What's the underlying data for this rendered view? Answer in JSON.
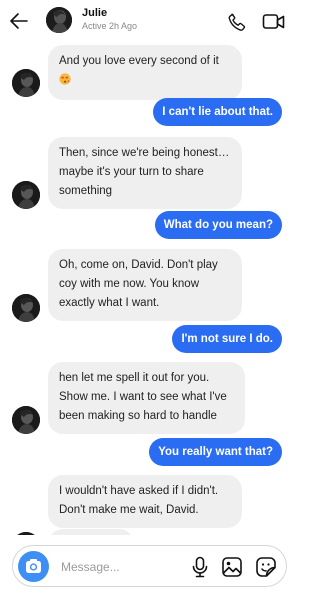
{
  "header": {
    "name": "Julie",
    "status": "Active 2h Ago",
    "icons": [
      "back-arrow-icon",
      "avatar",
      "phone-icon",
      "video-camera-icon"
    ]
  },
  "messages": [
    {
      "from": "them",
      "text": "And you love every second of it",
      "emoji": "heart-eyes-kiss-emoji"
    },
    {
      "from": "me",
      "text": "I can't lie about that."
    },
    {
      "from": "them",
      "text": "Then, since we're being honest… maybe it's your turn to share something"
    },
    {
      "from": "me",
      "text": "What do you mean?"
    },
    {
      "from": "them",
      "text": "Oh, come on, David. Don't play coy with me now. You know exactly what I want."
    },
    {
      "from": "me",
      "text": "I'm not sure I do."
    },
    {
      "from": "them",
      "text": "hen let me spell it out for you. Show me. I want to see what I've been making so hard to handle"
    },
    {
      "from": "me",
      "text": "You really want that?"
    },
    {
      "from": "them",
      "text": "I wouldn't have asked if I didn't. Don't make me wait, David."
    }
  ],
  "composer": {
    "placeholder": "Message...",
    "icons": [
      "camera-icon",
      "microphone-icon",
      "gallery-icon",
      "sticker-icon"
    ]
  },
  "colors": {
    "outgoing_bubble": "#2a6df3",
    "incoming_bubble": "#efefef",
    "camera_button": "#3d8ef5"
  }
}
